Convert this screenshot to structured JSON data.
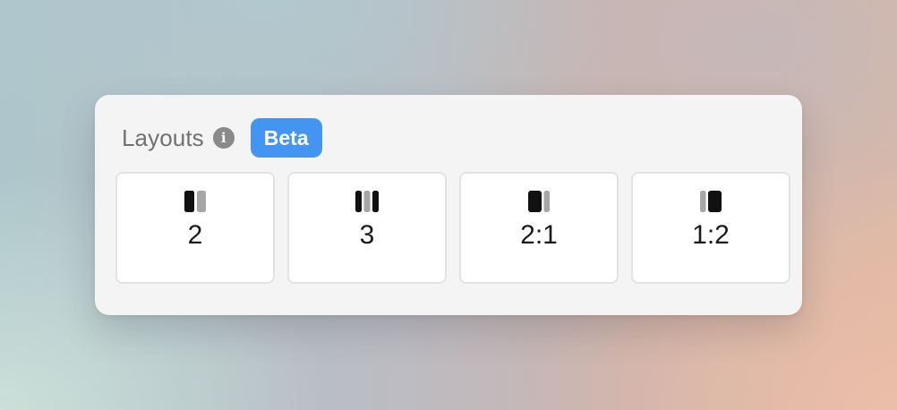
{
  "header": {
    "title": "Layouts",
    "info_icon": "info-icon",
    "badge": "Beta"
  },
  "colors": {
    "badge_bg": "#4495f2",
    "bar_dark": "#111111",
    "bar_light": "#a6a6a6"
  },
  "options": [
    {
      "label": "2",
      "icon": "layout-two-columns-icon"
    },
    {
      "label": "3",
      "icon": "layout-three-columns-icon"
    },
    {
      "label": "2:1",
      "icon": "layout-two-to-one-icon"
    },
    {
      "label": "1:2",
      "icon": "layout-one-to-two-icon"
    }
  ]
}
